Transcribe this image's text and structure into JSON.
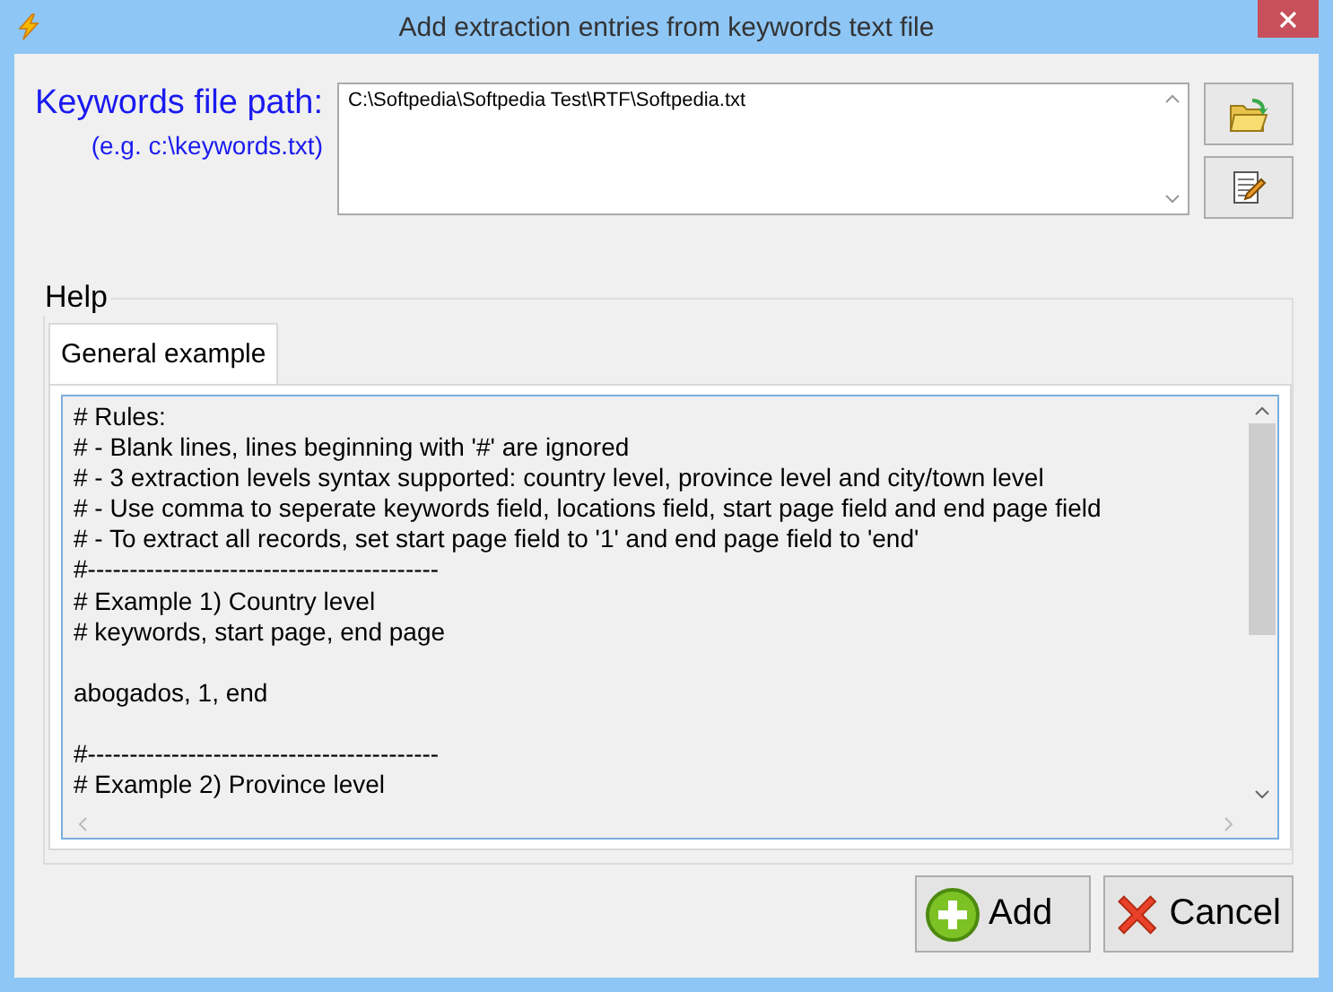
{
  "window": {
    "title": "Add extraction entries from keywords text file"
  },
  "path_label": "Keywords file path:",
  "path_hint": "(e.g. c:\\keywords.txt)",
  "path_value": "C:\\Softpedia\\Softpedia Test\\RTF\\Softpedia.txt",
  "help": {
    "title": "Help",
    "tabs": [
      {
        "label": "General example",
        "selected": true
      }
    ],
    "lines": [
      {
        "kind": "text",
        "text": "# Rules:"
      },
      {
        "kind": "text",
        "text": "# - Blank lines, lines beginning with '#' are ignored"
      },
      {
        "kind": "text",
        "text": "# - 3 extraction levels syntax supported: country level, province level and city/town level"
      },
      {
        "kind": "text",
        "text": "# - Use comma to seperate keywords field, locations field, start page field and end page field"
      },
      {
        "kind": "text",
        "text": "# - To extract all records, set start page field to '1' and end page field to 'end'"
      },
      {
        "kind": "text",
        "text": "#------------------------------------------"
      },
      {
        "kind": "text",
        "text": "# Example 1) Country level"
      },
      {
        "kind": "text",
        "text": "# keywords, start page, end page"
      },
      {
        "kind": "blank"
      },
      {
        "kind": "text",
        "text": "abogados, 1, end"
      },
      {
        "kind": "blank"
      },
      {
        "kind": "text",
        "text": "#------------------------------------------"
      },
      {
        "kind": "text",
        "text": "# Example 2) Province level"
      }
    ]
  },
  "buttons": [
    {
      "kind": "add",
      "label": "Add"
    },
    {
      "kind": "cancel",
      "label": "Cancel"
    }
  ]
}
